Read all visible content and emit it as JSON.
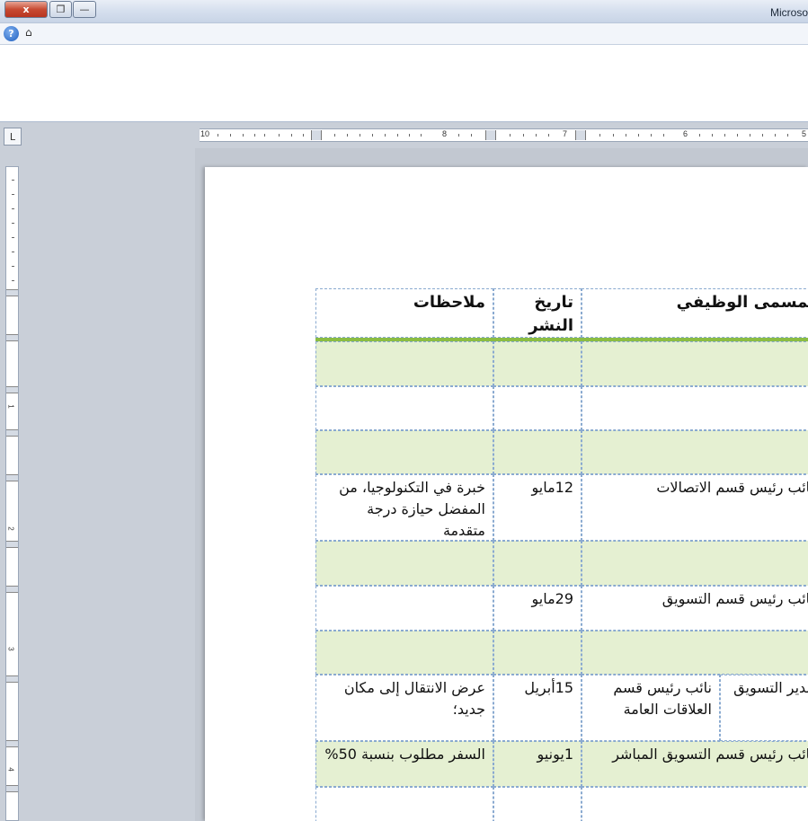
{
  "window": {
    "title": "Microso",
    "close_label": "x",
    "restore_label": "❐",
    "minimize_label": "—"
  },
  "help": {
    "icon_label": "?",
    "ribbon_toggle": "⌂"
  },
  "ruler": {
    "horizontal_labels": [
      "10",
      "8",
      "7",
      "6",
      "5"
    ],
    "vertical_labels": [
      "1",
      "2",
      "3",
      "4"
    ],
    "tab_selector": "L"
  },
  "table": {
    "headers": {
      "notes": "ملاحظات",
      "date": "تاريخ النشر",
      "title": "لمسمى الوظيفي"
    },
    "rows": [
      {
        "notes": "",
        "date": "",
        "title": ""
      },
      {
        "notes": "",
        "date": "",
        "title": ""
      },
      {
        "notes": "",
        "date": "",
        "title": ""
      },
      {
        "notes": "خبرة في التكنولوجيا، من المفضل حيازة درجة متقدمة",
        "date": "12مايو",
        "title": "نائب رئيس قسم الاتصالات"
      },
      {
        "notes": "",
        "date": "",
        "title": ""
      },
      {
        "notes": "",
        "date": "29مايو",
        "title": "نائب رئيس قسم التسويق"
      },
      {
        "notes": "",
        "date": "",
        "title": ""
      },
      {
        "notes": "عرض الانتقال إلى مكان جديد؛",
        "date": "15أبريل",
        "title_a": "نائب رئيس قسم العلاقات العامة",
        "title_b": "مدير التسويق"
      },
      {
        "notes": "السفر مطلوب بنسبة 50%",
        "date": "1يونيو",
        "title": "نائب رئيس قسم التسويق المباشر"
      },
      {
        "notes": "",
        "date": "",
        "title": ""
      }
    ]
  }
}
